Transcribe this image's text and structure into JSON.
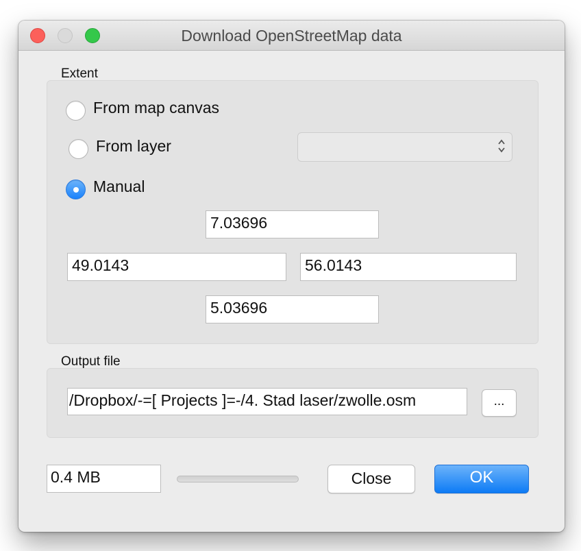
{
  "window": {
    "title": "Download OpenStreetMap data",
    "colors": {
      "close": "#fc605b",
      "minimize": "#dadada",
      "maximize": "#34c84a",
      "accent": "#1a82fb"
    }
  },
  "extent": {
    "label": "Extent",
    "options": [
      {
        "label": "From map canvas",
        "checked": false
      },
      {
        "label": "From layer",
        "checked": false
      },
      {
        "label": "Manual",
        "checked": true
      }
    ],
    "layer_select_value": "",
    "north": "7.03696",
    "west": "49.0143",
    "east": "56.0143",
    "south": "5.03696"
  },
  "output": {
    "label": "Output file",
    "path": "/Dropbox/-=[ Projects ]=-/4. Stad laser/zwolle.osm",
    "browse_label": "..."
  },
  "footer": {
    "size": "0.4 MB",
    "progress": 0,
    "close_label": "Close",
    "ok_label": "OK"
  }
}
